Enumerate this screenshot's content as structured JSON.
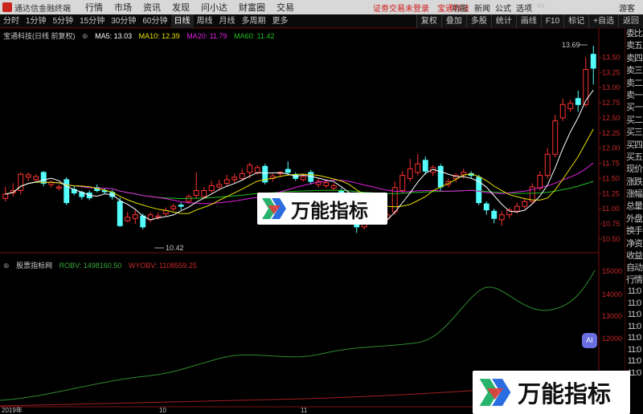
{
  "menubar": {
    "app_name": "通达信金融终端",
    "menus": [
      "行情",
      "市场",
      "资讯",
      "发现",
      "问小达",
      "财富圈",
      "交易"
    ],
    "status_text": "证劵交易未登录",
    "stock_link": "宝通科技",
    "right_menus": [
      "功能",
      "新闻",
      "公式",
      "选项"
    ],
    "user": "游客"
  },
  "toolbar": {
    "periods": [
      "分时",
      "1分钟",
      "5分钟",
      "15分钟",
      "30分钟",
      "60分钟",
      "日线",
      "周线",
      "月线",
      "多周期",
      "更多"
    ],
    "active_period": "日线",
    "tools": [
      "复权",
      "叠加",
      "多股",
      "统计",
      "画线",
      "F10",
      "标记",
      "+自选",
      "返回"
    ]
  },
  "main_legend": {
    "title": "宝通科技(日线 前复权)",
    "ma5": "MA5: 13.03",
    "ma10": "MA10: 12.39",
    "ma20": "MA20: 11.79",
    "ma60": "MA60: 11.42"
  },
  "sub_legend": {
    "title": "股票指标网",
    "robv": "ROBV: 1498160.50",
    "wyobv": "WYOBV: 1108559.25"
  },
  "price_axis": [
    "13.50",
    "13.25",
    "13.00",
    "12.75",
    "12.50",
    "12.25",
    "12.00",
    "11.75",
    "11.50",
    "11.25",
    "11.00",
    "10.75",
    "10.50"
  ],
  "indicator_axis": [
    "15000",
    "14000",
    "13000",
    "12000"
  ],
  "time_axis": [
    "2019年",
    "10",
    "11"
  ],
  "annotations": {
    "high": "13.69",
    "low": "10.42"
  },
  "rightbar": {
    "items": [
      "委比",
      "卖五",
      "卖四",
      "卖三",
      "卖二",
      "卖一",
      "买一",
      "买二",
      "买三",
      "买四",
      "买五",
      "现价",
      "涨跌",
      "涨幅",
      "总量",
      "外盘",
      "换手",
      "净资",
      "收益"
    ],
    "items2": [
      "自动",
      "行情",
      "11:0",
      "11:0",
      "11:0",
      "11:0",
      "11:0",
      "11:0",
      "11:0",
      "11:0"
    ]
  },
  "watermark": {
    "text": "万能指标"
  },
  "ai_badge": "AI",
  "chart_data": {
    "type": "candlestick",
    "ylim": [
      10.3,
      13.85
    ],
    "candles": [
      {
        "o": 11.17,
        "c": 11.24,
        "h": 11.36,
        "l": 11.12
      },
      {
        "o": 11.26,
        "c": 11.3,
        "h": 11.42,
        "l": 11.2
      },
      {
        "o": 11.3,
        "c": 11.57,
        "h": 11.6,
        "l": 11.24
      },
      {
        "o": 11.52,
        "c": 11.56,
        "h": 11.6,
        "l": 11.46
      },
      {
        "o": 11.48,
        "c": 11.53,
        "h": 11.57,
        "l": 11.43
      },
      {
        "o": 11.6,
        "c": 11.42,
        "h": 11.62,
        "l": 11.37
      },
      {
        "o": 11.4,
        "c": 11.44,
        "h": 11.47,
        "l": 11.35
      },
      {
        "o": 11.34,
        "c": 11.36,
        "h": 11.4,
        "l": 11.3
      },
      {
        "o": 11.48,
        "c": 11.1,
        "h": 11.52,
        "l": 11.06
      },
      {
        "o": 11.32,
        "c": 11.26,
        "h": 11.37,
        "l": 11.22
      },
      {
        "o": 11.27,
        "c": 11.2,
        "h": 11.3,
        "l": 11.15
      },
      {
        "o": 11.26,
        "c": 11.18,
        "h": 11.3,
        "l": 11.14
      },
      {
        "o": 11.35,
        "c": 11.3,
        "h": 11.4,
        "l": 11.27
      },
      {
        "o": 11.3,
        "c": 11.28,
        "h": 11.34,
        "l": 11.24
      },
      {
        "o": 11.27,
        "c": 11.2,
        "h": 11.31,
        "l": 11.15
      },
      {
        "o": 11.12,
        "c": 10.72,
        "h": 11.18,
        "l": 10.7
      },
      {
        "o": 10.8,
        "c": 10.86,
        "h": 10.95,
        "l": 10.78
      },
      {
        "o": 10.84,
        "c": 10.9,
        "h": 10.98,
        "l": 10.75
      },
      {
        "o": 10.88,
        "c": 10.7,
        "h": 10.92,
        "l": 10.66
      },
      {
        "o": 10.82,
        "c": 10.9,
        "h": 10.94,
        "l": 10.78
      },
      {
        "o": 10.86,
        "c": 10.88,
        "h": 10.94,
        "l": 10.82
      },
      {
        "o": 10.92,
        "c": 10.97,
        "h": 11.02,
        "l": 10.88
      },
      {
        "o": 11.0,
        "c": 11.04,
        "h": 11.08,
        "l": 10.96
      },
      {
        "o": 11.06,
        "c": 11.04,
        "h": 11.1,
        "l": 10.98
      },
      {
        "o": 11.12,
        "c": 11.2,
        "h": 11.24,
        "l": 11.08
      },
      {
        "o": 11.22,
        "c": 11.3,
        "h": 11.6,
        "l": 11.18
      },
      {
        "o": 11.2,
        "c": 11.3,
        "h": 11.36,
        "l": 11.16
      },
      {
        "o": 11.3,
        "c": 11.38,
        "h": 11.46,
        "l": 11.26
      },
      {
        "o": 11.36,
        "c": 11.4,
        "h": 11.48,
        "l": 11.32
      },
      {
        "o": 11.42,
        "c": 11.48,
        "h": 11.56,
        "l": 11.38
      },
      {
        "o": 11.48,
        "c": 11.52,
        "h": 11.58,
        "l": 11.42
      },
      {
        "o": 11.5,
        "c": 11.58,
        "h": 11.66,
        "l": 11.46
      },
      {
        "o": 11.6,
        "c": 11.72,
        "h": 11.76,
        "l": 11.5
      },
      {
        "o": 11.6,
        "c": 11.68,
        "h": 11.72,
        "l": 11.56
      },
      {
        "o": 11.7,
        "c": 11.44,
        "h": 11.74,
        "l": 11.4
      },
      {
        "o": 11.5,
        "c": 11.54,
        "h": 11.58,
        "l": 11.45
      },
      {
        "o": 11.58,
        "c": 11.6,
        "h": 11.62,
        "l": 11.52
      },
      {
        "o": 11.65,
        "c": 11.6,
        "h": 11.78,
        "l": 11.56
      },
      {
        "o": 11.56,
        "c": 11.5,
        "h": 11.6,
        "l": 11.46
      },
      {
        "o": 11.48,
        "c": 11.53,
        "h": 11.58,
        "l": 11.45
      },
      {
        "o": 11.6,
        "c": 11.45,
        "h": 11.64,
        "l": 11.4
      },
      {
        "o": 11.4,
        "c": 11.45,
        "h": 11.5,
        "l": 11.35
      },
      {
        "o": 11.38,
        "c": 11.43,
        "h": 11.48,
        "l": 11.34
      },
      {
        "o": 11.34,
        "c": 11.38,
        "h": 11.42,
        "l": 11.3
      },
      {
        "o": 11.3,
        "c": 11.1,
        "h": 11.34,
        "l": 11.06
      },
      {
        "o": 11.05,
        "c": 10.98,
        "h": 11.1,
        "l": 10.94
      },
      {
        "o": 10.9,
        "c": 10.7,
        "h": 10.94,
        "l": 10.6
      },
      {
        "o": 10.7,
        "c": 10.76,
        "h": 10.8,
        "l": 10.66
      },
      {
        "o": 10.78,
        "c": 10.86,
        "h": 10.9,
        "l": 10.74
      },
      {
        "o": 10.8,
        "c": 10.85,
        "h": 10.94,
        "l": 10.75
      },
      {
        "o": 10.84,
        "c": 10.9,
        "h": 11.0,
        "l": 10.8
      },
      {
        "o": 10.95,
        "c": 11.35,
        "h": 11.45,
        "l": 10.9
      },
      {
        "o": 11.3,
        "c": 11.55,
        "h": 11.62,
        "l": 11.25
      },
      {
        "o": 11.5,
        "c": 11.66,
        "h": 11.82,
        "l": 11.45
      },
      {
        "o": 11.6,
        "c": 11.74,
        "h": 11.9,
        "l": 11.55
      },
      {
        "o": 11.8,
        "c": 11.62,
        "h": 11.86,
        "l": 11.56
      },
      {
        "o": 11.6,
        "c": 11.68,
        "h": 11.72,
        "l": 11.54
      },
      {
        "o": 11.7,
        "c": 11.36,
        "h": 11.74,
        "l": 11.3
      },
      {
        "o": 11.4,
        "c": 11.45,
        "h": 11.5,
        "l": 11.35
      },
      {
        "o": 11.5,
        "c": 11.55,
        "h": 11.58,
        "l": 11.44
      },
      {
        "o": 11.56,
        "c": 11.6,
        "h": 11.66,
        "l": 11.5
      },
      {
        "o": 11.58,
        "c": 11.55,
        "h": 11.62,
        "l": 11.5
      },
      {
        "o": 11.52,
        "c": 11.1,
        "h": 11.56,
        "l": 11.06
      },
      {
        "o": 11.08,
        "c": 10.98,
        "h": 11.12,
        "l": 10.9
      },
      {
        "o": 10.96,
        "c": 10.84,
        "h": 11.0,
        "l": 10.76
      },
      {
        "o": 10.82,
        "c": 10.9,
        "h": 10.96,
        "l": 10.72
      },
      {
        "o": 10.9,
        "c": 10.98,
        "h": 11.02,
        "l": 10.84
      },
      {
        "o": 10.96,
        "c": 11.04,
        "h": 11.1,
        "l": 10.92
      },
      {
        "o": 11.04,
        "c": 11.12,
        "h": 11.18,
        "l": 11.0
      },
      {
        "o": 11.12,
        "c": 11.36,
        "h": 11.42,
        "l": 11.08
      },
      {
        "o": 11.34,
        "c": 11.55,
        "h": 11.62,
        "l": 11.3
      },
      {
        "o": 11.55,
        "c": 11.9,
        "h": 12.0,
        "l": 11.5
      },
      {
        "o": 11.9,
        "c": 12.45,
        "h": 12.55,
        "l": 11.85
      },
      {
        "o": 12.5,
        "c": 12.72,
        "h": 12.82,
        "l": 12.45
      },
      {
        "o": 12.65,
        "c": 12.74,
        "h": 12.8,
        "l": 12.6
      },
      {
        "o": 12.82,
        "c": 12.72,
        "h": 12.95,
        "l": 12.6
      },
      {
        "o": 12.72,
        "c": 13.3,
        "h": 13.5,
        "l": 12.68
      },
      {
        "o": 13.55,
        "c": 13.32,
        "h": 13.69,
        "l": 13.05
      }
    ]
  }
}
